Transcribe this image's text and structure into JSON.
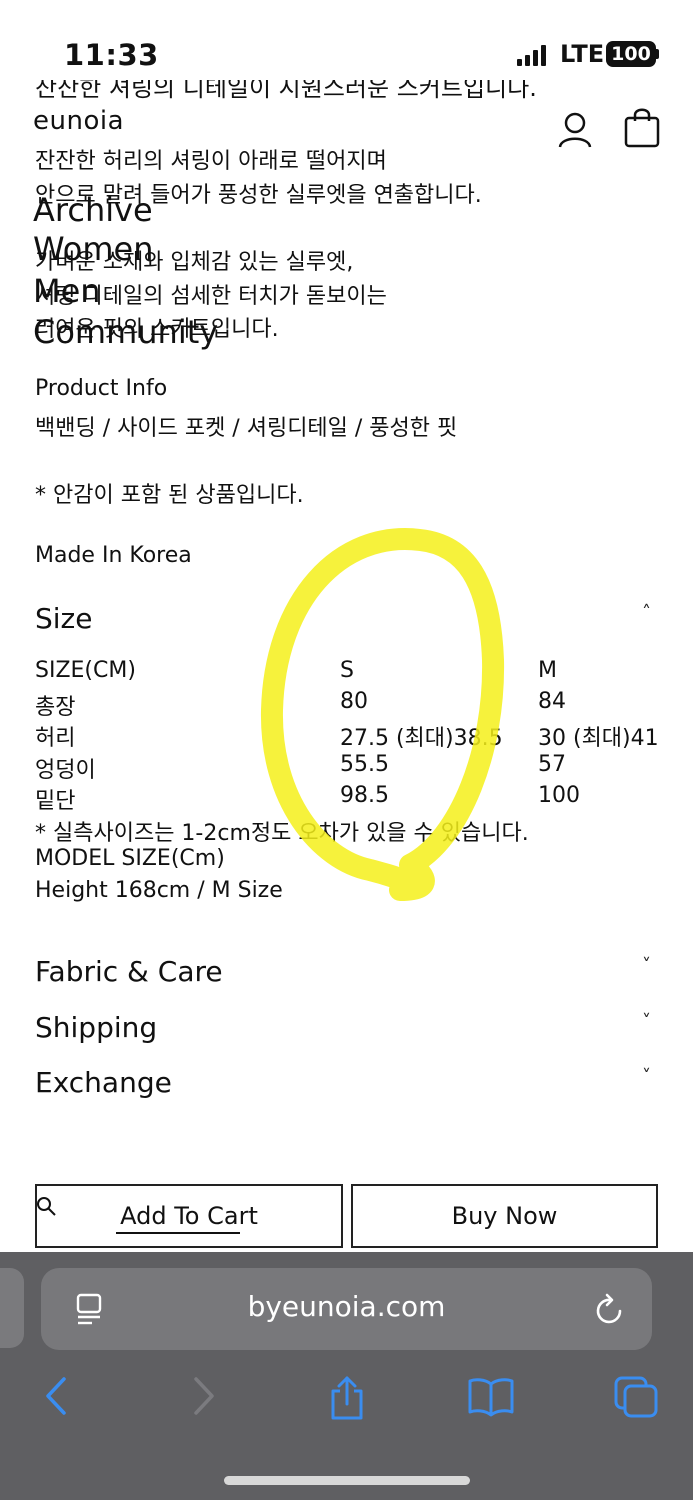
{
  "status_bar": {
    "time": "11:33",
    "network": "LTE",
    "battery": "100"
  },
  "header": {
    "brand": "eunoia",
    "user_icon": "user-icon",
    "bag_icon": "shopping-bag-icon"
  },
  "clipped_text": "잔잔한 셔링의 디테일이 시원스러운 스커트입니다.",
  "description": {
    "line1": "잔잔한 허리의 셔링이 아래로 떨어지며",
    "line2": "안으로 말려 들어가 풍성한 실루엣을 연출합니다.",
    "line3": "가벼운 소재와 입체감 있는 실루엣,",
    "line4": "셔링 디테일의 섬세한 터치가 돋보이는",
    "line5": "러여운 핏의 스커트입니다."
  },
  "nav": {
    "archive": "Archive",
    "women": "Women",
    "men": "Men",
    "community": "Community"
  },
  "product_info": {
    "title": "Product Info",
    "details": "백밴딩 / 사이드 포켓 / 셔링디테일 / 풍성한 핏",
    "note": "* 안감이 포함 된 상품입니다.",
    "origin": "Made In Korea"
  },
  "size": {
    "title": "Size",
    "chevron": "˄",
    "headers": [
      "SIZE(CM)",
      "S",
      "M"
    ],
    "rows": [
      [
        "총장",
        "80",
        "84"
      ],
      [
        "허리",
        "27.5 (최대)38.5",
        "30 (최대)41"
      ],
      [
        "엉덩이",
        "55.5",
        "57"
      ],
      [
        "밑단",
        "98.5",
        "100"
      ]
    ],
    "note": "* 실측사이즈는 1-2cm정도 오차가 있을 수 있습니다.",
    "model_label": "MODEL SIZE(Cm)",
    "model_value": "Height 168cm / M Size"
  },
  "accordions": {
    "fabric": "Fabric & Care",
    "shipping": "Shipping",
    "exchange": "Exchange",
    "chevron": "˅"
  },
  "buttons": {
    "add_to_cart": "Add To Cart",
    "buy_now": "Buy Now"
  },
  "browser": {
    "url": "byeunoia.com"
  },
  "colors": {
    "highlight": "#f4f01a",
    "browser_bg": "#5f5f62",
    "url_bar": "#78787b",
    "toolbar_icon": "#3a8df0"
  }
}
